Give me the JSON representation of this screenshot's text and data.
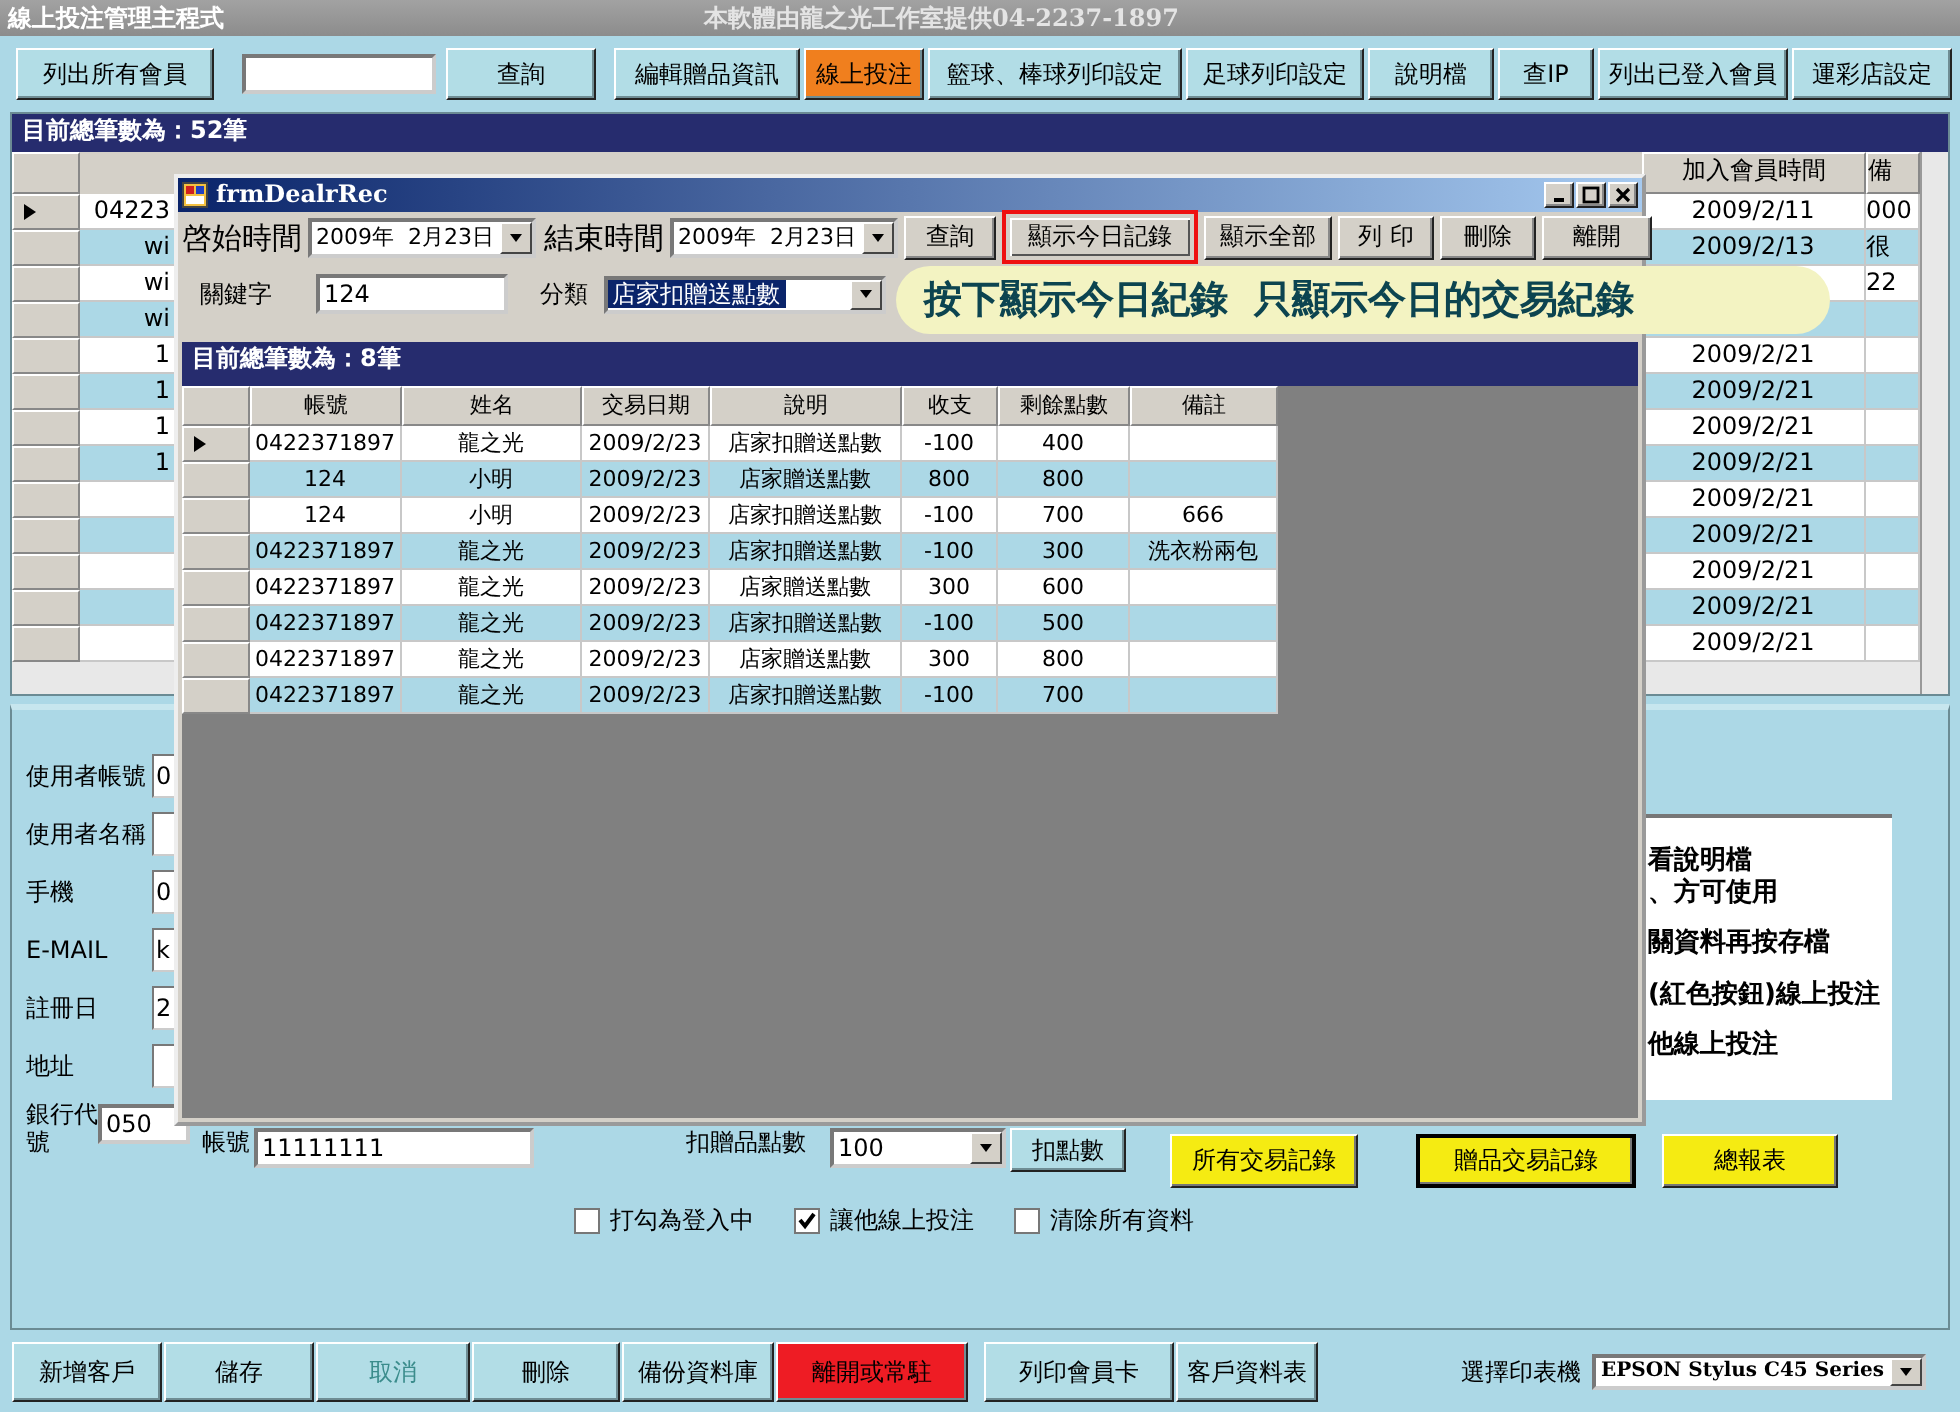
{
  "window": {
    "title": "線上投注管理主程式",
    "credit": "本軟體由龍之光工作室提供04-2237-1897"
  },
  "toolbar": [
    {
      "kind": "button",
      "label": "列出所有會員",
      "selected": false
    },
    {
      "kind": "field"
    },
    {
      "kind": "button",
      "label": "查詢",
      "selected": false
    },
    {
      "kind": "button",
      "label": "編輯贈品資訊",
      "selected": false
    },
    {
      "kind": "button",
      "label": "線上投注",
      "selected": true
    },
    {
      "kind": "button",
      "label": "籃球、棒球列印設定",
      "selected": false
    },
    {
      "kind": "button",
      "label": "足球列印設定",
      "selected": false
    },
    {
      "kind": "button",
      "label": "說明檔",
      "selected": false
    },
    {
      "kind": "button",
      "label": "查IP",
      "selected": false
    },
    {
      "kind": "button",
      "label": "列出已登入會員",
      "selected": false
    },
    {
      "kind": "button",
      "label": "運彩店設定",
      "selected": false
    }
  ],
  "member_grid": {
    "count_label": "目前總筆數為：52筆",
    "columns": [
      "加入會員時間",
      "備"
    ],
    "rows": [
      {
        "current": true,
        "column_1": "04223",
        "joined": "2009/2/11",
        "note": "000"
      },
      {
        "current": false,
        "column_1": "wi",
        "joined": "2009/2/13",
        "note": "很"
      },
      {
        "current": false,
        "column_1": "wi",
        "note": "22"
      },
      {
        "current": false,
        "column_1": "wi"
      },
      {
        "current": false,
        "column_1": "1",
        "joined": "2009/2/21"
      },
      {
        "current": false,
        "column_1": "1",
        "joined": "2009/2/21"
      },
      {
        "current": false,
        "column_1": "1",
        "joined": "2009/2/21"
      },
      {
        "current": false,
        "column_1": "1",
        "joined": "2009/2/21"
      },
      {
        "current": false,
        "joined": "2009/2/21"
      },
      {
        "current": false,
        "joined": "2009/2/21"
      },
      {
        "current": false,
        "joined": "2009/2/21"
      },
      {
        "current": false,
        "joined": "2009/2/21"
      },
      {
        "current": false,
        "joined": "2009/2/21"
      }
    ]
  },
  "member_form": {
    "fields": [
      {
        "label": "使用者帳號",
        "value": "0"
      },
      {
        "label": "使用者名稱"
      },
      {
        "label": "手機",
        "value": "0"
      },
      {
        "label": "E-MAIL",
        "value": "k"
      },
      {
        "label": "註冊日",
        "value": "2"
      },
      {
        "label": "地址"
      }
    ],
    "bank_label": "銀行代號",
    "bank_code": "050",
    "account_label": "帳號",
    "account": "11111111",
    "deduct_label": "扣贈品點數",
    "deduct_value": "100",
    "deduct_button": "扣點數",
    "report_buttons": [
      {
        "label": "所有交易記錄",
        "focused": false
      },
      {
        "label": "贈品交易記錄",
        "focused": true
      },
      {
        "label": "總報表",
        "focused": false
      }
    ],
    "checkboxes": [
      {
        "label": "打勾為登入中",
        "checked": false
      },
      {
        "label": "讓他線上投注",
        "checked": true
      },
      {
        "label": "清除所有資料",
        "checked": false
      }
    ],
    "info_lines": [
      "看說明檔",
      "、方可使用",
      "關資料再按存檔",
      "(紅色按鈕)線上投注",
      "他線上投注"
    ]
  },
  "bottom_bar": {
    "buttons": [
      {
        "label": "新增客戶",
        "kind": "normal"
      },
      {
        "label": "儲存",
        "kind": "normal"
      },
      {
        "label": "取消",
        "kind": "disabled"
      },
      {
        "label": "刪除",
        "kind": "normal"
      },
      {
        "label": "備份資料庫",
        "kind": "normal"
      },
      {
        "label": "離開或常駐",
        "kind": "alert"
      },
      {
        "label": "列印會員卡",
        "kind": "normal"
      },
      {
        "label": "客戶資料表",
        "kind": "normal"
      }
    ],
    "printer_label": "選擇印表機",
    "printer": "EPSON Stylus C45 Series"
  },
  "dialog": {
    "title": "frmDealrRec",
    "start_label": "啓始時間",
    "start_date": "2009年  2月23日",
    "end_label": "結束時間",
    "end_date": "2009年  2月23日",
    "buttons": [
      {
        "label": "查詢",
        "highlighted": false
      },
      {
        "label": "顯示今日記錄",
        "highlighted": true
      },
      {
        "label": "顯示全部",
        "highlighted": false
      },
      {
        "label": "列 印",
        "highlighted": false
      },
      {
        "label": "刪除",
        "highlighted": false
      },
      {
        "label": "離開",
        "highlighted": false
      }
    ],
    "keyword_label": "關鍵字",
    "keyword": "124",
    "category_label": "分類",
    "category": "店家扣贈送點數",
    "count_label": "目前總筆數為：8筆",
    "columns": [
      "帳號",
      "姓名",
      "交易日期",
      "說明",
      "收支",
      "剩餘點數",
      "備註"
    ],
    "rows": [
      {
        "current": true,
        "cells": [
          "0422371897",
          "龍之光",
          "2009/2/23",
          "店家扣贈送點數",
          "-100",
          "400",
          ""
        ]
      },
      {
        "current": false,
        "cells": [
          "124",
          "小明",
          "2009/2/23",
          "店家贈送點數",
          "800",
          "800",
          ""
        ]
      },
      {
        "current": false,
        "cells": [
          "124",
          "小明",
          "2009/2/23",
          "店家扣贈送點數",
          "-100",
          "700",
          "666"
        ]
      },
      {
        "current": false,
        "cells": [
          "0422371897",
          "龍之光",
          "2009/2/23",
          "店家扣贈送點數",
          "-100",
          "300",
          "洗衣粉兩包"
        ]
      },
      {
        "current": false,
        "cells": [
          "0422371897",
          "龍之光",
          "2009/2/23",
          "店家贈送點數",
          "300",
          "600",
          ""
        ]
      },
      {
        "current": false,
        "cells": [
          "0422371897",
          "龍之光",
          "2009/2/23",
          "店家扣贈送點數",
          "-100",
          "500",
          ""
        ]
      },
      {
        "current": false,
        "cells": [
          "0422371897",
          "龍之光",
          "2009/2/23",
          "店家贈送點數",
          "300",
          "800",
          ""
        ]
      },
      {
        "current": false,
        "cells": [
          "0422371897",
          "龍之光",
          "2009/2/23",
          "店家扣贈送點數",
          "-100",
          "700",
          ""
        ]
      }
    ]
  },
  "callout": "按下顯示今日紀錄  只顯示今日的交易紀錄"
}
